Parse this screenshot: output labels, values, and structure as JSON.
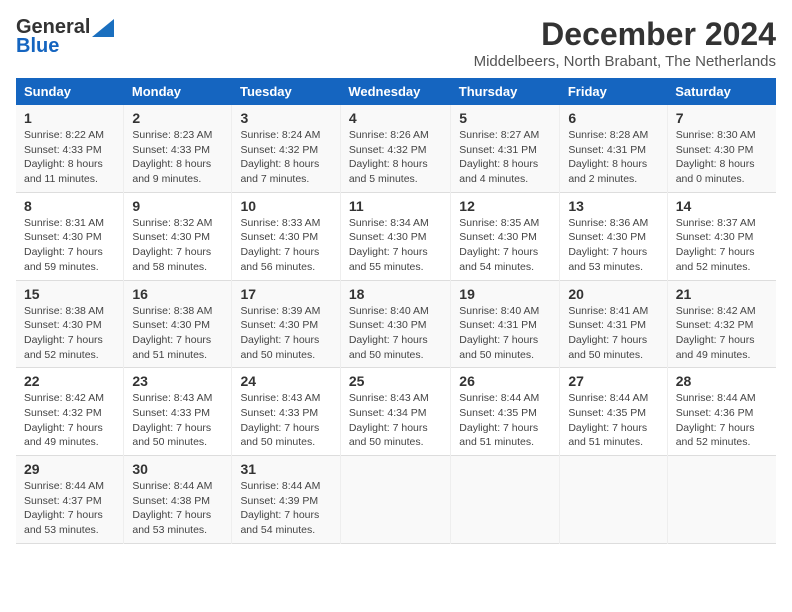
{
  "header": {
    "logo_line1": "General",
    "logo_line2": "Blue",
    "title": "December 2024",
    "subtitle": "Middelbeers, North Brabant, The Netherlands"
  },
  "columns": [
    "Sunday",
    "Monday",
    "Tuesday",
    "Wednesday",
    "Thursday",
    "Friday",
    "Saturday"
  ],
  "weeks": [
    [
      {
        "day": "1",
        "info": "Sunrise: 8:22 AM\nSunset: 4:33 PM\nDaylight: 8 hours\nand 11 minutes."
      },
      {
        "day": "2",
        "info": "Sunrise: 8:23 AM\nSunset: 4:33 PM\nDaylight: 8 hours\nand 9 minutes."
      },
      {
        "day": "3",
        "info": "Sunrise: 8:24 AM\nSunset: 4:32 PM\nDaylight: 8 hours\nand 7 minutes."
      },
      {
        "day": "4",
        "info": "Sunrise: 8:26 AM\nSunset: 4:32 PM\nDaylight: 8 hours\nand 5 minutes."
      },
      {
        "day": "5",
        "info": "Sunrise: 8:27 AM\nSunset: 4:31 PM\nDaylight: 8 hours\nand 4 minutes."
      },
      {
        "day": "6",
        "info": "Sunrise: 8:28 AM\nSunset: 4:31 PM\nDaylight: 8 hours\nand 2 minutes."
      },
      {
        "day": "7",
        "info": "Sunrise: 8:30 AM\nSunset: 4:30 PM\nDaylight: 8 hours\nand 0 minutes."
      }
    ],
    [
      {
        "day": "8",
        "info": "Sunrise: 8:31 AM\nSunset: 4:30 PM\nDaylight: 7 hours\nand 59 minutes."
      },
      {
        "day": "9",
        "info": "Sunrise: 8:32 AM\nSunset: 4:30 PM\nDaylight: 7 hours\nand 58 minutes."
      },
      {
        "day": "10",
        "info": "Sunrise: 8:33 AM\nSunset: 4:30 PM\nDaylight: 7 hours\nand 56 minutes."
      },
      {
        "day": "11",
        "info": "Sunrise: 8:34 AM\nSunset: 4:30 PM\nDaylight: 7 hours\nand 55 minutes."
      },
      {
        "day": "12",
        "info": "Sunrise: 8:35 AM\nSunset: 4:30 PM\nDaylight: 7 hours\nand 54 minutes."
      },
      {
        "day": "13",
        "info": "Sunrise: 8:36 AM\nSunset: 4:30 PM\nDaylight: 7 hours\nand 53 minutes."
      },
      {
        "day": "14",
        "info": "Sunrise: 8:37 AM\nSunset: 4:30 PM\nDaylight: 7 hours\nand 52 minutes."
      }
    ],
    [
      {
        "day": "15",
        "info": "Sunrise: 8:38 AM\nSunset: 4:30 PM\nDaylight: 7 hours\nand 52 minutes."
      },
      {
        "day": "16",
        "info": "Sunrise: 8:38 AM\nSunset: 4:30 PM\nDaylight: 7 hours\nand 51 minutes."
      },
      {
        "day": "17",
        "info": "Sunrise: 8:39 AM\nSunset: 4:30 PM\nDaylight: 7 hours\nand 50 minutes."
      },
      {
        "day": "18",
        "info": "Sunrise: 8:40 AM\nSunset: 4:30 PM\nDaylight: 7 hours\nand 50 minutes."
      },
      {
        "day": "19",
        "info": "Sunrise: 8:40 AM\nSunset: 4:31 PM\nDaylight: 7 hours\nand 50 minutes."
      },
      {
        "day": "20",
        "info": "Sunrise: 8:41 AM\nSunset: 4:31 PM\nDaylight: 7 hours\nand 50 minutes."
      },
      {
        "day": "21",
        "info": "Sunrise: 8:42 AM\nSunset: 4:32 PM\nDaylight: 7 hours\nand 49 minutes."
      }
    ],
    [
      {
        "day": "22",
        "info": "Sunrise: 8:42 AM\nSunset: 4:32 PM\nDaylight: 7 hours\nand 49 minutes."
      },
      {
        "day": "23",
        "info": "Sunrise: 8:43 AM\nSunset: 4:33 PM\nDaylight: 7 hours\nand 50 minutes."
      },
      {
        "day": "24",
        "info": "Sunrise: 8:43 AM\nSunset: 4:33 PM\nDaylight: 7 hours\nand 50 minutes."
      },
      {
        "day": "25",
        "info": "Sunrise: 8:43 AM\nSunset: 4:34 PM\nDaylight: 7 hours\nand 50 minutes."
      },
      {
        "day": "26",
        "info": "Sunrise: 8:44 AM\nSunset: 4:35 PM\nDaylight: 7 hours\nand 51 minutes."
      },
      {
        "day": "27",
        "info": "Sunrise: 8:44 AM\nSunset: 4:35 PM\nDaylight: 7 hours\nand 51 minutes."
      },
      {
        "day": "28",
        "info": "Sunrise: 8:44 AM\nSunset: 4:36 PM\nDaylight: 7 hours\nand 52 minutes."
      }
    ],
    [
      {
        "day": "29",
        "info": "Sunrise: 8:44 AM\nSunset: 4:37 PM\nDaylight: 7 hours\nand 53 minutes."
      },
      {
        "day": "30",
        "info": "Sunrise: 8:44 AM\nSunset: 4:38 PM\nDaylight: 7 hours\nand 53 minutes."
      },
      {
        "day": "31",
        "info": "Sunrise: 8:44 AM\nSunset: 4:39 PM\nDaylight: 7 hours\nand 54 minutes."
      },
      {
        "day": "",
        "info": ""
      },
      {
        "day": "",
        "info": ""
      },
      {
        "day": "",
        "info": ""
      },
      {
        "day": "",
        "info": ""
      }
    ]
  ]
}
